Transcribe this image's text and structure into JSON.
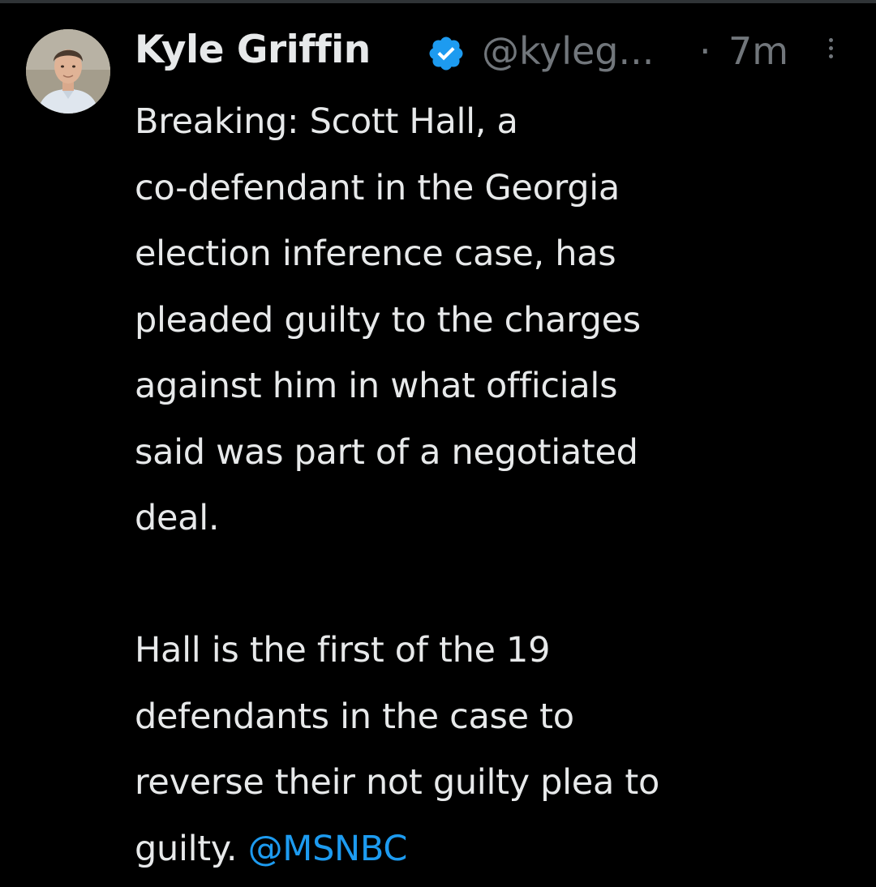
{
  "tweet": {
    "author_name": "Kyle Griffin",
    "handle": "@kyleg...",
    "separator": "·",
    "time": "7m",
    "paragraph1": [
      "Breaking: Scott Hall, a",
      "co-defendant in the Georgia",
      "election inference case, has",
      "pleaded guilty to the charges",
      "against him in what officials",
      "said was part of a negotiated",
      "deal."
    ],
    "paragraph2": [
      "Hall is the first of the 19",
      "defendants in the case to",
      "reverse their not guilty plea to"
    ],
    "last_line_text": "guilty.",
    "mention": "@MSNBC"
  },
  "icons": {
    "verified": "verified-badge-icon",
    "more": "more-options-icon"
  },
  "colors": {
    "background": "#000000",
    "text": "#e7e9ea",
    "secondary": "#71767b",
    "accent": "#1d9bf0"
  }
}
